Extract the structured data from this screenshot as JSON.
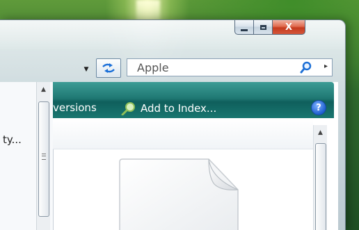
{
  "window": {
    "caption": {
      "minimize": "minimize",
      "maximize": "maximize",
      "close": "X"
    }
  },
  "address": {
    "search_value": "Apple"
  },
  "nav": {
    "truncated_item": "ty..."
  },
  "command_bar": {
    "versions_label": "versions",
    "add_to_index_label": "Add to Index...",
    "help_label": "?"
  },
  "icons": {
    "refresh": "refresh-icon",
    "search": "search-icon",
    "add_to_index": "magnifier-icon",
    "help": "help-icon",
    "file": "blank-file-icon"
  },
  "colors": {
    "command_bar": "#1f7873",
    "close_button": "#c53a1e",
    "help_button": "#1d5fd0"
  }
}
